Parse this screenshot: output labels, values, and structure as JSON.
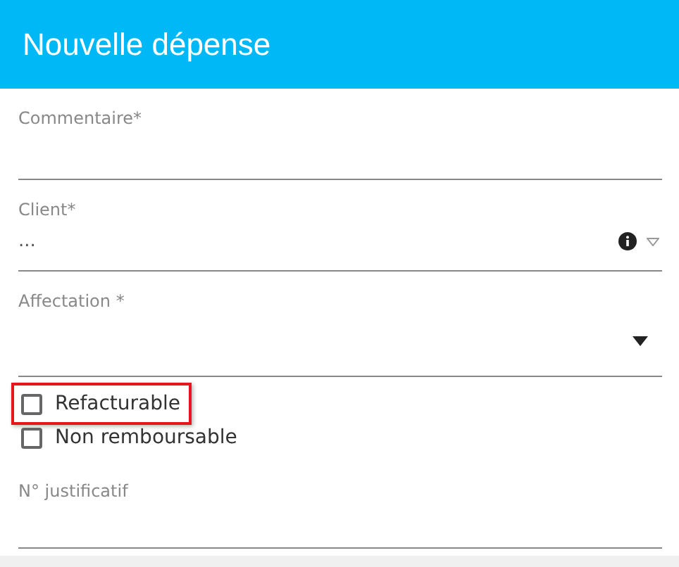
{
  "window": {
    "title": "Nouvelle dépense"
  },
  "fields": [
    {
      "kind": "text",
      "label": "Commentaire*"
    },
    {
      "kind": "lookup",
      "label": "Client*",
      "value": "..."
    },
    {
      "kind": "select",
      "label": "Affectation *"
    }
  ],
  "options": [
    {
      "label": "Refacturable",
      "checked": false,
      "highlighted": true
    },
    {
      "label": "Non remboursable",
      "checked": false,
      "highlighted": false
    }
  ],
  "fields_after": [
    {
      "kind": "text",
      "label": "N° justificatif"
    }
  ]
}
